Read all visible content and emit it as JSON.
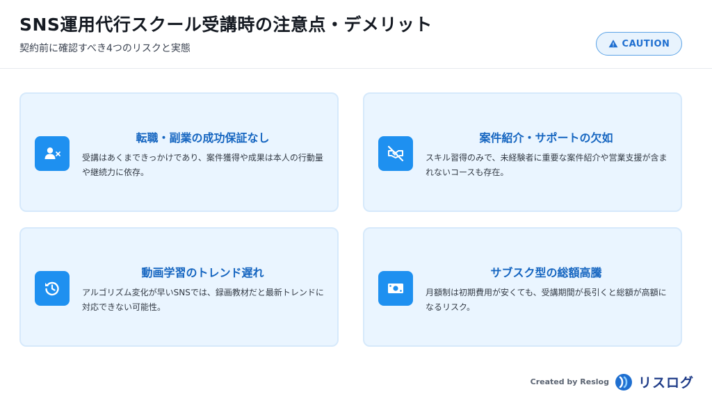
{
  "header": {
    "title": "SNS運用代行スクール受講時の注意点・デメリット",
    "subtitle": "契約前に確認すべき4つのリスクと実態",
    "badge": "CAUTION"
  },
  "cards": [
    {
      "icon": "user-x-icon",
      "title": "転職・副業の成功保証なし",
      "text": "受講はあくまできっかけであり、案件獲得や成果は本人の行動量や継続力に依存。"
    },
    {
      "icon": "handshake-slash-icon",
      "title": "案件紹介・サポートの欠如",
      "text": "スキル習得のみで、未経験者に重要な案件紹介や営業支援が含まれないコースも存在。"
    },
    {
      "icon": "history-icon",
      "title": "動画学習のトレンド遅れ",
      "text": "アルゴリズム変化が早いSNSでは、録画教材だと最新トレンドに対応できない可能性。"
    },
    {
      "icon": "money-bill-icon",
      "title": "サブスク型の総額高騰",
      "text": "月額制は初期費用が安くても、受講期間が長引くと総額が高額になるリスク。"
    }
  ],
  "footer": {
    "credit": "Created by Reslog",
    "logo_text": "リスログ"
  },
  "colors": {
    "accent": "#1e90f0",
    "card_title": "#1565c0",
    "card_bg": "#eaf5ff"
  }
}
